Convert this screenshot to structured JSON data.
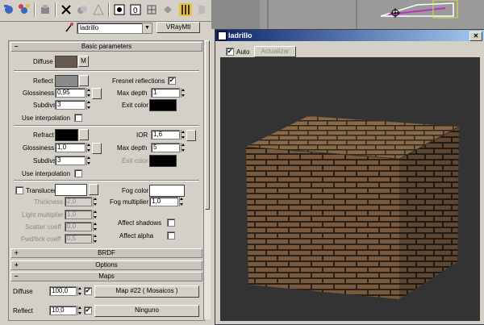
{
  "material": {
    "name": "ladrillo",
    "type_button": "VRayMtl"
  },
  "rollouts": {
    "basic": "Basic parameters",
    "brdf": "BRDF",
    "options": "Options",
    "maps": "Maps"
  },
  "basic": {
    "diffuse_label": "Diffuse",
    "diffuse_map_btn": "M",
    "reflect_label": "Reflect",
    "fresnel_label": "Fresnel reflections",
    "fresnel_checked": "✔",
    "gloss_label": "Glossiness",
    "gloss_value": "0,95",
    "maxdepth_label": "Max depth",
    "maxdepth_value": "1",
    "subdivs_label": "Subdivs",
    "subdivs_value": "3",
    "exitcolor_label": "Exit color",
    "use_interp_label": "Use interpolation",
    "refract_label": "Refract",
    "ior_label": "IOR",
    "ior_value": "1,6",
    "r_gloss_label": "Glossiness",
    "r_gloss_value": "1,0",
    "r_maxdepth_label": "Max depth",
    "r_maxdepth_value": "5",
    "r_subdivs_label": "Subdivs",
    "r_subdivs_value": "3",
    "r_exitcolor_label": "Exit color",
    "r_use_interp_label": "Use interpolation",
    "translucent_label": "Translucent",
    "thickness_label": "Thickness",
    "thickness_value": "2,0",
    "lightmult_label": "Light multiplier",
    "lightmult_value": "1,0",
    "scatter_label": "Scatter coeff",
    "scatter_value": "0,0",
    "fwdbck_label": "Fwd/bck coeff",
    "fwdbck_value": "0,5",
    "fogcolor_label": "Fog color",
    "fogmult_label": "Fog multiplier",
    "fogmult_value": "1,0",
    "affect_shadows_label": "Affect shadows",
    "affect_alpha_label": "Affect alpha"
  },
  "maps": {
    "diffuse_label": "Diffuse",
    "diffuse_amount": "100,0",
    "diffuse_checked": "✔",
    "diffuse_map": "Map #22  ( Mosaicos )",
    "reflect_label": "Reflect",
    "reflect_amount": "10,0",
    "reflect_checked": "✔",
    "reflect_map": "Ninguno"
  },
  "preview": {
    "title": "ladrillo",
    "auto_label": "Auto",
    "auto_checked": "✔",
    "update_btn": "Actualizar",
    "close": "✕"
  },
  "colors": {
    "diffuse_swatch": "#665a4e",
    "reflect_swatch": "#8a8a8a",
    "exit_color": "#000000",
    "refract_swatch": "#000000",
    "fog_color": "#ffffff",
    "brick": "#7a5a3a",
    "mortar": "#2a2520"
  }
}
